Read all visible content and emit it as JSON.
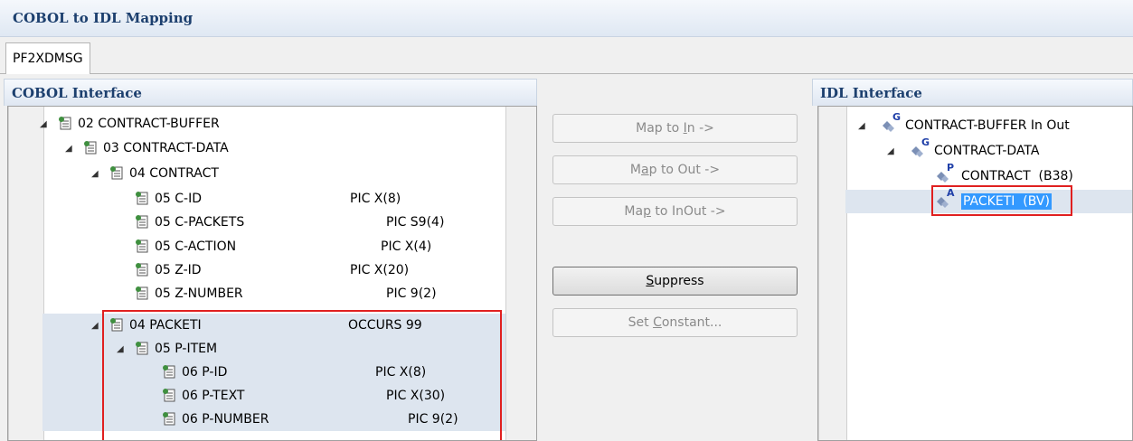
{
  "window": {
    "title": "COBOL to IDL Mapping",
    "tab": "PF2XDMSG"
  },
  "cobol": {
    "header": "COBOL Interface",
    "rows": [
      {
        "label": "02 CONTRACT-BUFFER",
        "pic": ""
      },
      {
        "label": "03 CONTRACT-DATA",
        "pic": ""
      },
      {
        "label": "04 CONTRACT",
        "pic": ""
      },
      {
        "label": "05 C-ID",
        "pic": "PIC X(8)"
      },
      {
        "label": "05 C-PACKETS",
        "pic": "PIC S9(4)"
      },
      {
        "label": "05 C-ACTION",
        "pic": "PIC X(4)"
      },
      {
        "label": "05 Z-ID",
        "pic": "PIC X(20)"
      },
      {
        "label": "05 Z-NUMBER",
        "pic": "PIC 9(2)"
      },
      {
        "label": "04 PACKETI",
        "pic": "OCCURS 99"
      },
      {
        "label": "05 P-ITEM",
        "pic": ""
      },
      {
        "label": "06 P-ID",
        "pic": "PIC X(8)"
      },
      {
        "label": "06 P-TEXT",
        "pic": "PIC X(30)"
      },
      {
        "label": "06 P-NUMBER",
        "pic": "PIC 9(2)"
      }
    ]
  },
  "actions": {
    "map_in": {
      "pre": "Map to ",
      "key": "I",
      "post": "n ->"
    },
    "map_out": {
      "pre": "M",
      "key": "a",
      "post": "p to Out ->"
    },
    "map_inout": {
      "pre": "Ma",
      "key": "p",
      "post": " to InOut ->"
    },
    "suppress": {
      "pre": "",
      "key": "S",
      "post": "uppress"
    },
    "set_constant": {
      "pre": "Set ",
      "key": "C",
      "post": "onstant..."
    }
  },
  "idl": {
    "header": "IDL Interface",
    "rows": [
      {
        "badge": "G",
        "label": "CONTRACT-BUFFER In Out"
      },
      {
        "badge": "G",
        "label": "CONTRACT-DATA"
      },
      {
        "badge": "P",
        "label": "CONTRACT  (B38)"
      },
      {
        "badge": "A",
        "label": "PACKETI  (BV)"
      }
    ]
  },
  "colors": {
    "highlight_box": "#e02020",
    "selection": "#3399ff",
    "header_text": "#1c3f6e"
  }
}
